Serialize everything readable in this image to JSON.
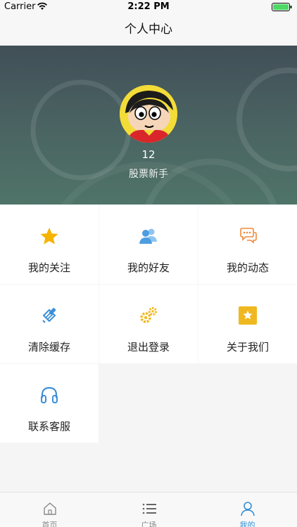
{
  "status_bar": {
    "carrier": "Carrier",
    "time": "2:22 PM"
  },
  "nav": {
    "title": "个人中心"
  },
  "profile": {
    "username": "12",
    "level": "股票新手"
  },
  "menu": [
    {
      "label": "我的关注",
      "icon": "star-icon",
      "color": "#f5b400"
    },
    {
      "label": "我的好友",
      "icon": "friends-icon",
      "color": "#5aa8e8"
    },
    {
      "label": "我的动态",
      "icon": "chat-icon",
      "color": "#f08a3c"
    },
    {
      "label": "清除缓存",
      "icon": "broom-icon",
      "color": "#3b8fd8"
    },
    {
      "label": "退出登录",
      "icon": "gears-icon",
      "color": "#f0b820"
    },
    {
      "label": "关于我们",
      "icon": "about-star-icon",
      "color": "#f0b820"
    },
    {
      "label": "联系客服",
      "icon": "headphones-icon",
      "color": "#3b8fd8"
    }
  ],
  "tabs": [
    {
      "label": "首页",
      "icon": "home-icon",
      "active": false
    },
    {
      "label": "广场",
      "icon": "list-icon",
      "active": false
    },
    {
      "label": "我的",
      "icon": "person-icon",
      "active": true
    }
  ],
  "colors": {
    "accent": "#2f8fd8",
    "header_top": "#414f57",
    "header_bottom": "#4f7468"
  }
}
